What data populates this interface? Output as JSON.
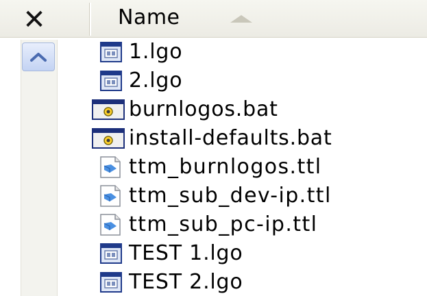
{
  "header": {
    "close_glyph": "✕",
    "name_column_label": "Name",
    "sort_direction": "ascending"
  },
  "files": [
    {
      "name": "1.lgo",
      "type": "lgo",
      "icon": "lgo-file-icon"
    },
    {
      "name": "2.lgo",
      "type": "lgo",
      "icon": "lgo-file-icon"
    },
    {
      "name": "burnlogos.bat",
      "type": "bat",
      "icon": "batch-file-icon"
    },
    {
      "name": "install-defaults.bat",
      "type": "bat",
      "icon": "batch-file-icon"
    },
    {
      "name": "ttm_burnlogos.ttl",
      "type": "ttl",
      "icon": "ttl-file-icon"
    },
    {
      "name": "ttm_sub_dev-ip.ttl",
      "type": "ttl",
      "icon": "ttl-file-icon"
    },
    {
      "name": "ttm_sub_pc-ip.ttl",
      "type": "ttl",
      "icon": "ttl-file-icon"
    },
    {
      "name": "TEST 1.lgo",
      "type": "lgo",
      "icon": "lgo-file-icon"
    },
    {
      "name": "TEST 2.lgo",
      "type": "lgo",
      "icon": "lgo-file-icon"
    }
  ],
  "colors": {
    "header_bg": "#ecebe4",
    "scroll_button": "#c3d3f3",
    "lgo_icon_frame": "#1f3a8a",
    "bat_icon_frame": "#1c2f7a",
    "ttl_icon_blue": "#4a90e2"
  }
}
